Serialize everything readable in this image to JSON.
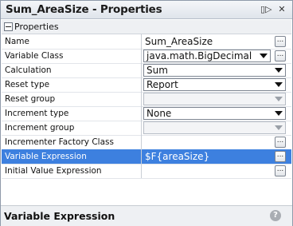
{
  "window": {
    "title": "Sum_AreaSize - Properties",
    "dock_icon": "▯▷",
    "close_icon": "✕"
  },
  "section": {
    "label": "Properties"
  },
  "rows": [
    {
      "name": "Name",
      "value": "Sum_AreaSize",
      "editor": "ellipsis"
    },
    {
      "name": "Variable Class",
      "value": "java.math.BigDecimal",
      "editor": "combo-ellipsis"
    },
    {
      "name": "Calculation",
      "value": "Sum",
      "editor": "combo"
    },
    {
      "name": "Reset type",
      "value": "Report",
      "editor": "combo"
    },
    {
      "name": "Reset group",
      "value": "",
      "editor": "combo-disabled"
    },
    {
      "name": "Increment type",
      "value": "None",
      "editor": "combo"
    },
    {
      "name": "Increment group",
      "value": "",
      "editor": "combo-disabled"
    },
    {
      "name": "Incrementer Factory Class",
      "value": "",
      "editor": "ellipsis"
    },
    {
      "name": "Variable Expression",
      "value": "$F{areaSize}",
      "editor": "ellipsis",
      "selected": true
    },
    {
      "name": "Initial Value Expression",
      "value": "",
      "editor": "ellipsis"
    }
  ],
  "footer": {
    "title": "Variable Expression",
    "help_icon": "?"
  },
  "ellipsis_label": "..."
}
